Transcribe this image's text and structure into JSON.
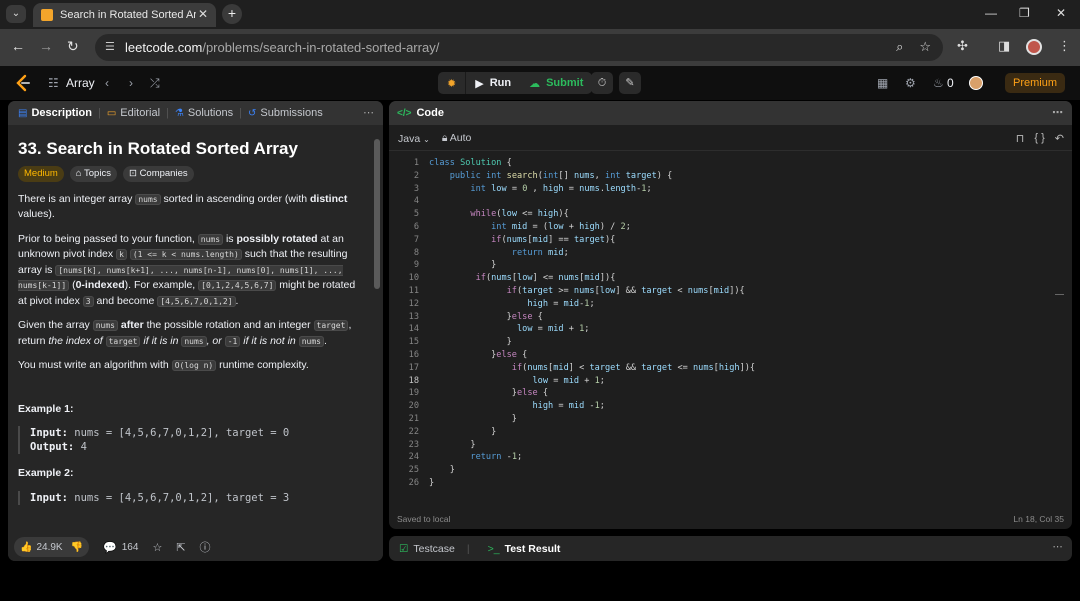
{
  "browser": {
    "tab_title": "Search in Rotated Sorted Array",
    "url_host": "leetcode.com",
    "url_path": "/problems/search-in-rotated-sorted-array/"
  },
  "app_header": {
    "problem_list": "Array",
    "run_label": "Run",
    "submit_label": "Submit",
    "streak_count": "0",
    "premium_label": "Premium"
  },
  "left_panel": {
    "tabs": [
      {
        "label": "Description",
        "icon": "description-icon"
      },
      {
        "label": "Editorial",
        "icon": "book-icon"
      },
      {
        "label": "Solutions",
        "icon": "flask-icon"
      },
      {
        "label": "Submissions",
        "icon": "history-icon"
      }
    ],
    "title": "33. Search in Rotated Sorted Array",
    "chips": {
      "difficulty": "Medium",
      "topics": "Topics",
      "companies": "Companies"
    },
    "p1": {
      "a": "There is an integer array ",
      "nums": "nums",
      "b": " sorted in ascending order (with ",
      "distinct": "distinct",
      "c": " values)."
    },
    "p2": {
      "a": "Prior to being passed to your function, ",
      "nums": "nums",
      "b": " is ",
      "possibly_rotated": "possibly rotated",
      "c": " at an unknown pivot index ",
      "k": "k",
      "d": " ",
      "k_range": "(1 <= k < nums.length)",
      "e": " such that the resulting array is ",
      "rotated_form": "[nums[k], nums[k+1], ..., nums[n-1], nums[0], nums[1], ..., nums[k-1]]",
      "f": " (",
      "zero_indexed": "0-indexed",
      "g": "). For example, ",
      "example_array": "[0,1,2,4,5,6,7]",
      "h": " might be rotated at pivot index ",
      "pivot": "3",
      "i": " and become ",
      "rotated_array": "[4,5,6,7,0,1,2]",
      "j": "."
    },
    "p3": {
      "a": "Given the array ",
      "nums": "nums",
      "b": " ",
      "after": "after",
      "c": " the possible rotation and an integer ",
      "target": "target",
      "d": ", return ",
      "e": "the index of ",
      "target2": "target",
      "f": " if it is in ",
      "nums2": "nums",
      "g": ", or ",
      "neg1": "-1",
      "h": " if it is not in ",
      "nums3": "nums",
      "i": "."
    },
    "p4": {
      "a": "You must write an algorithm with ",
      "complexity": "O(log n)",
      "b": " runtime complexity."
    },
    "example1": {
      "heading": "Example 1:",
      "input_label": "Input:",
      "input": " nums = [4,5,6,7,0,1,2], target = 0",
      "output_label": "Output:",
      "output": " 4"
    },
    "example2": {
      "heading": "Example 2:",
      "input_label": "Input:",
      "input": " nums = [4,5,6,7,0,1,2], target = 3"
    },
    "footer": {
      "likes": "24.9K",
      "comments": "164"
    }
  },
  "code_panel": {
    "title": "Code",
    "language": "Java",
    "mode": "Auto",
    "saved_status": "Saved to local",
    "cursor_position": "Ln 18, Col 35",
    "current_line": 18,
    "lines": [
      "class Solution {",
      "    public int search(int[] nums, int target) {",
      "        int low = 0 , high = nums.length-1;",
      "",
      "        while(low <= high){",
      "            int mid = (low + high) / 2;",
      "            if(nums[mid] == target){",
      "                return mid;",
      "            }",
      "         if(nums[low] <= nums[mid]){",
      "               if(target >= nums[low] && target < nums[mid]){",
      "                   high = mid-1;",
      "               }else {",
      "                 low = mid + 1;",
      "               }",
      "            }else {",
      "                if(nums[mid] < target && target <= nums[high]){",
      "                    low = mid + 1;",
      "                }else {",
      "                    high = mid -1;",
      "                }",
      "            }",
      "        }",
      "        return -1;",
      "    }",
      "}"
    ]
  },
  "result_panel": {
    "testcase_label": "Testcase",
    "result_label": "Test Result"
  }
}
